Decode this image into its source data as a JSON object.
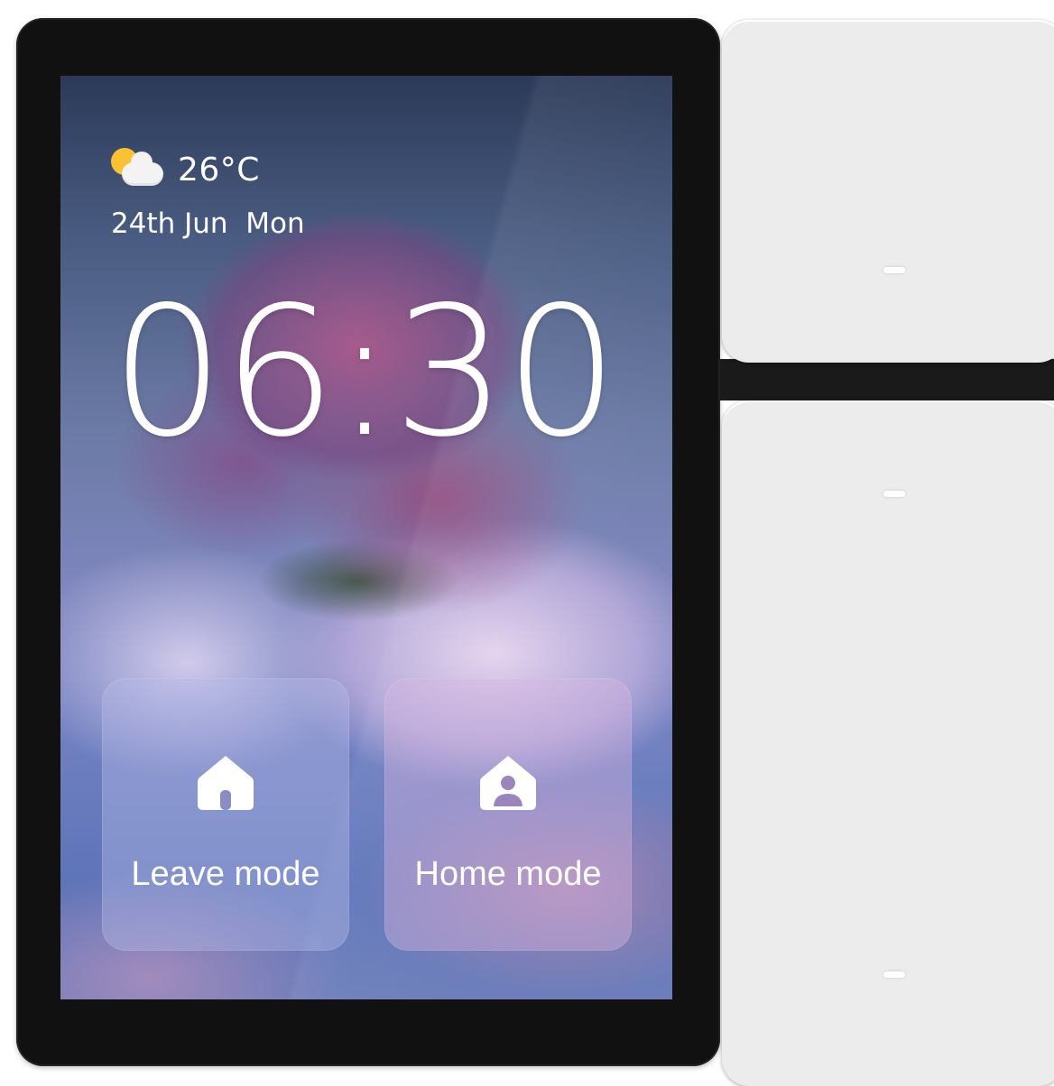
{
  "weather": {
    "icon": "partly-cloudy-icon",
    "temperature": "26°C"
  },
  "date": {
    "day": "24th Jun",
    "weekday": "Mon"
  },
  "clock": {
    "time": "06:30"
  },
  "modes": [
    {
      "label": "Leave mode",
      "icon": "house-icon"
    },
    {
      "label": "Home mode",
      "icon": "house-person-icon"
    }
  ],
  "colors": {
    "bezel": "#111111",
    "switch_panel": "#ececec",
    "sun": "#f8c233",
    "text": "#ffffff"
  }
}
